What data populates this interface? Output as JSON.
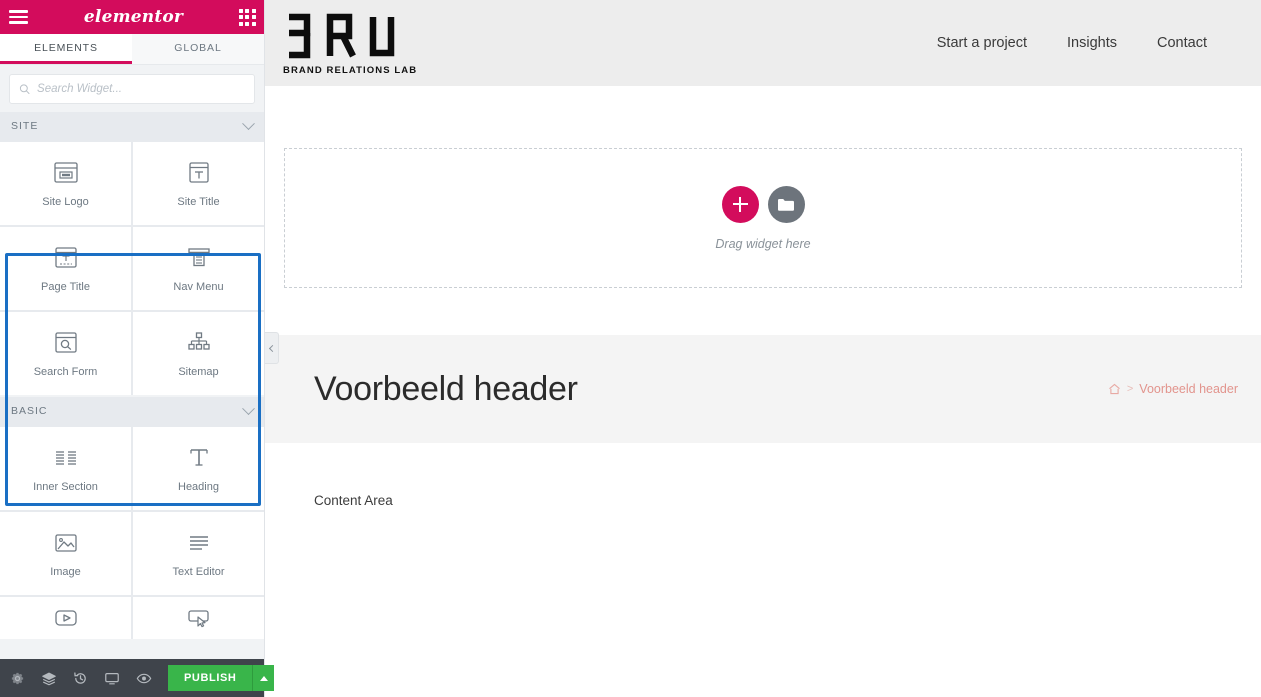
{
  "panel": {
    "header": {
      "menu_icon": "hamburger-icon",
      "logo_text": "elementor",
      "apps_icon": "grid-apps-icon"
    },
    "tabs": [
      {
        "label": "ELEMENTS",
        "active": true
      },
      {
        "label": "GLOBAL",
        "active": false
      }
    ],
    "search": {
      "value": "",
      "placeholder": "Search Widget..."
    },
    "sections": [
      {
        "title": "SITE",
        "highlighted": true,
        "widgets": [
          {
            "label": "Site Logo",
            "icon": "site-logo-icon"
          },
          {
            "label": "Site Title",
            "icon": "site-title-icon"
          },
          {
            "label": "Page Title",
            "icon": "page-title-icon"
          },
          {
            "label": "Nav Menu",
            "icon": "nav-menu-icon"
          },
          {
            "label": "Search Form",
            "icon": "search-form-icon"
          },
          {
            "label": "Sitemap",
            "icon": "sitemap-icon"
          }
        ]
      },
      {
        "title": "BASIC",
        "highlighted": false,
        "widgets": [
          {
            "label": "Inner Section",
            "icon": "inner-section-icon"
          },
          {
            "label": "Heading",
            "icon": "heading-icon"
          },
          {
            "label": "Image",
            "icon": "image-icon"
          },
          {
            "label": "Text Editor",
            "icon": "text-editor-icon"
          },
          {
            "label": "",
            "icon": "video-icon"
          },
          {
            "label": "",
            "icon": "button-icon"
          }
        ]
      }
    ],
    "footer": {
      "tools": [
        {
          "name": "settings-gear-icon"
        },
        {
          "name": "navigator-layers-icon"
        },
        {
          "name": "history-icon"
        },
        {
          "name": "responsive-mode-icon"
        },
        {
          "name": "preview-eye-icon"
        }
      ],
      "publish_label": "PUBLISH",
      "publish_color": "#39b54a"
    }
  },
  "canvas": {
    "collapse_handle": "chevron-left-icon",
    "site_header": {
      "brand_mark": "BRL",
      "brand_tagline": "BRAND RELATIONS LAB",
      "nav": [
        {
          "label": "Start a project"
        },
        {
          "label": "Insights"
        },
        {
          "label": "Contact"
        }
      ]
    },
    "dropzone": {
      "add_icon": "plus-icon",
      "template_icon": "folder-icon",
      "text": "Drag widget here",
      "add_color": "#d30c5c"
    },
    "hero": {
      "title": "Voorbeeld header",
      "breadcrumb": {
        "home_icon": "home-icon",
        "separator": ">",
        "current": "Voorbeeld header"
      }
    },
    "content": {
      "text": "Content Area"
    }
  },
  "colors": {
    "elementor_pink": "#d30c5c",
    "highlight_blue": "#1a6fc4",
    "publish_green": "#39b54a"
  }
}
